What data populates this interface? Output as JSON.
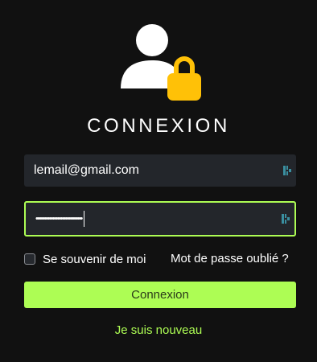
{
  "header": {
    "title": "CONNEXION"
  },
  "form": {
    "email_value": "lemail@gmail.com",
    "password_masked": "••••••••••••••••••••••••••••",
    "remember_label": "Se souvenir de moi",
    "remember_checked": false,
    "forgot_label": "Mot de passe oublié ?",
    "submit_label": "Connexion",
    "register_label": "Je suis nouveau"
  },
  "icons": {
    "logo": "user-lock-icon",
    "field_action": "password-manager-icon"
  },
  "colors": {
    "background": "#111111",
    "accent": "#adfd54",
    "lock": "#ffc107",
    "field": "#23262b"
  }
}
